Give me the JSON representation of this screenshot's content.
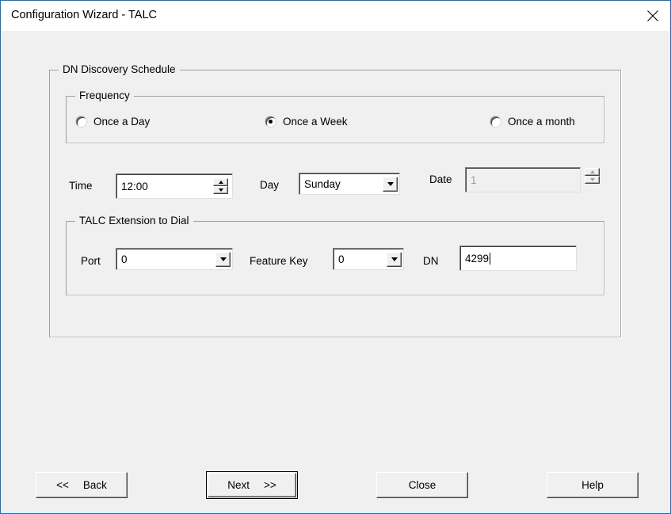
{
  "window": {
    "title": "Configuration Wizard - TALC",
    "close_icon": "close-icon",
    "accent_color": "#0078d7",
    "dialog_bg": "#f0f0f0"
  },
  "schedule_group": {
    "title": "DN Discovery Schedule",
    "frequency_group": {
      "title": "Frequency",
      "options": [
        {
          "label": "Once a Day",
          "selected": false
        },
        {
          "label": "Once a Week",
          "selected": true
        },
        {
          "label": "Once a month",
          "selected": false
        }
      ]
    },
    "time": {
      "label": "Time",
      "value": "12:00",
      "spinner_up_icon": "triangle-up-icon",
      "spinner_down_icon": "triangle-down-icon"
    },
    "day": {
      "label": "Day",
      "value": "Sunday",
      "dropdown_icon": "chevron-down-icon"
    },
    "date": {
      "label": "Date",
      "value": "1",
      "disabled": true,
      "spinner_up_icon": "triangle-up-icon",
      "spinner_down_icon": "triangle-down-icon"
    },
    "extension_group": {
      "title": "TALC Extension to Dial",
      "port": {
        "label": "Port",
        "value": "0",
        "dropdown_icon": "chevron-down-icon"
      },
      "feature_key": {
        "label": "Feature Key",
        "value": "0",
        "dropdown_icon": "chevron-down-icon"
      },
      "dn": {
        "label": "DN",
        "value": "4299",
        "focused": true
      }
    }
  },
  "buttons": {
    "back_prefix": "<<",
    "back_label": "Back",
    "next_label": "Next",
    "next_suffix": ">>",
    "close_label": "Close",
    "help_label": "Help"
  }
}
